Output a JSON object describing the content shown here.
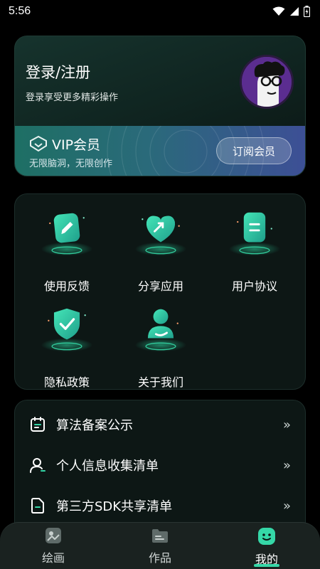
{
  "status_bar": {
    "time": "5:56"
  },
  "profile": {
    "login_title": "登录/注册",
    "login_subtitle": "登录享受更多精彩操作",
    "vip": {
      "title": "VIP会员",
      "subtitle": "无限脑洞，无限创作",
      "subscribe_label": "订阅会员"
    }
  },
  "features": [
    {
      "label": "使用反馈",
      "icon": "feedback-pencil-icon"
    },
    {
      "label": "分享应用",
      "icon": "share-heart-icon"
    },
    {
      "label": "用户协议",
      "icon": "agreement-doc-icon"
    },
    {
      "label": "隐私政策",
      "icon": "privacy-shield-icon"
    },
    {
      "label": "关于我们",
      "icon": "about-person-icon"
    }
  ],
  "links": [
    {
      "label": "算法备案公示",
      "icon": "calendar-doc-icon",
      "chevron": "»"
    },
    {
      "label": "个人信息收集清单",
      "icon": "user-outline-icon",
      "chevron": "»"
    },
    {
      "label": "第三方SDK共享清单",
      "icon": "file-icon",
      "chevron": "»"
    }
  ],
  "bottom_nav": {
    "items": [
      {
        "label": "绘画",
        "icon": "image-icon"
      },
      {
        "label": "作品",
        "icon": "folder-icon"
      },
      {
        "label": "我的",
        "icon": "smile-icon"
      }
    ],
    "active": "我的"
  },
  "colors": {
    "accent": "#35d7a7",
    "background": "#000000",
    "card": "#0d1715"
  }
}
